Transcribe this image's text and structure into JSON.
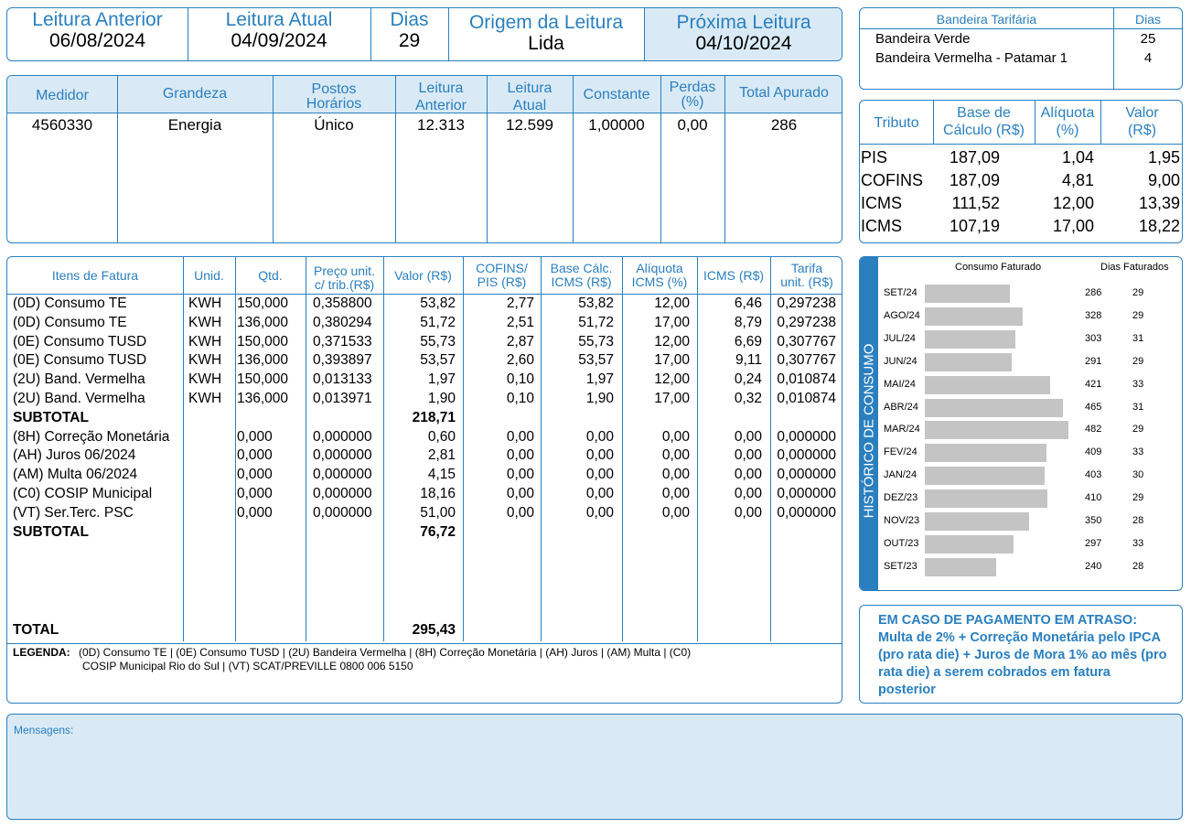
{
  "readings": {
    "anterior_label": "Leitura Anterior",
    "anterior_value": "06/08/2024",
    "atual_label": "Leitura Atual",
    "atual_value": "04/09/2024",
    "dias_label": "Dias",
    "dias_value": "29",
    "origem_label": "Origem da Leitura",
    "origem_value": "Lida",
    "proxima_label": "Próxima Leitura",
    "proxima_value": "04/10/2024"
  },
  "bandeira": {
    "header": "Bandeira Tarifária",
    "dias_header": "Dias",
    "rows": [
      {
        "name": "Bandeira Verde",
        "dias": "25"
      },
      {
        "name": "Bandeira Vermelha - Patamar 1",
        "dias": "4"
      }
    ]
  },
  "medidor": {
    "headers": {
      "medidor": "Medidor",
      "grandeza": "Grandeza",
      "postos_1": "Postos",
      "postos_2": "Horários",
      "anterior_1": "Leitura",
      "anterior_2": "Anterior",
      "atual_1": "Leitura",
      "atual_2": "Atual",
      "constante": "Constante",
      "perdas_1": "Perdas",
      "perdas_2": "(%)",
      "total": "Total Apurado"
    },
    "row": {
      "medidor": "4560330",
      "grandeza": "Energia",
      "postos": "Único",
      "anterior": "12.313",
      "atual": "12.599",
      "constante": "1,00000",
      "perdas": "0,00",
      "total": "286"
    }
  },
  "tributos": {
    "headers": {
      "tributo": "Tributo",
      "base_1": "Base de",
      "base_2": "Cálculo (R$)",
      "aliq_1": "Alíquota",
      "aliq_2": "(%)",
      "valor_1": "Valor",
      "valor_2": "(R$)"
    },
    "rows": [
      {
        "tributo": "PIS",
        "base": "187,09",
        "aliquota": "1,04",
        "valor": "1,95"
      },
      {
        "tributo": "COFINS",
        "base": "187,09",
        "aliquota": "4,81",
        "valor": "9,00"
      },
      {
        "tributo": "ICMS",
        "base": "111,52",
        "aliquota": "12,00",
        "valor": "13,39"
      },
      {
        "tributo": "ICMS",
        "base": "107,19",
        "aliquota": "17,00",
        "valor": "18,22"
      }
    ]
  },
  "itens": {
    "headers": {
      "itens": "Itens de Fatura",
      "unid": "Unid.",
      "qtd": "Qtd.",
      "preco_1": "Preço unit.",
      "preco_2": "c/ trib.(R$)",
      "valor": "Valor (R$)",
      "cofins_1": "COFINS/",
      "cofins_2": "PIS (R$)",
      "base_1": "Base Cálc.",
      "base_2": "ICMS (R$)",
      "aliq_1": "Alíquota",
      "aliq_2": "ICMS (%)",
      "icms": "ICMS (R$)",
      "tarifa_1": "Tarifa",
      "tarifa_2": "unit. (R$)"
    },
    "rows": [
      {
        "item": "(0D) Consumo TE",
        "unid": "KWH",
        "qtd": "150,000",
        "preco": "0,358800",
        "valor": "53,82",
        "cofins": "2,77",
        "base": "53,82",
        "aliq": "12,00",
        "icms": "6,46",
        "tarifa": "0,297238"
      },
      {
        "item": "(0D) Consumo TE",
        "unid": "KWH",
        "qtd": "136,000",
        "preco": "0,380294",
        "valor": "51,72",
        "cofins": "2,51",
        "base": "51,72",
        "aliq": "17,00",
        "icms": "8,79",
        "tarifa": "0,297238"
      },
      {
        "item": "(0E) Consumo TUSD",
        "unid": "KWH",
        "qtd": "150,000",
        "preco": "0,371533",
        "valor": "55,73",
        "cofins": "2,87",
        "base": "55,73",
        "aliq": "12,00",
        "icms": "6,69",
        "tarifa": "0,307767"
      },
      {
        "item": "(0E) Consumo TUSD",
        "unid": "KWH",
        "qtd": "136,000",
        "preco": "0,393897",
        "valor": "53,57",
        "cofins": "2,60",
        "base": "53,57",
        "aliq": "17,00",
        "icms": "9,11",
        "tarifa": "0,307767"
      },
      {
        "item": "(2U) Band. Vermelha",
        "unid": "KWH",
        "qtd": "150,000",
        "preco": "0,013133",
        "valor": "1,97",
        "cofins": "0,10",
        "base": "1,97",
        "aliq": "12,00",
        "icms": "0,24",
        "tarifa": "0,010874"
      },
      {
        "item": "(2U) Band. Vermelha",
        "unid": "KWH",
        "qtd": "136,000",
        "preco": "0,013971",
        "valor": "1,90",
        "cofins": "0,10",
        "base": "1,90",
        "aliq": "17,00",
        "icms": "0,32",
        "tarifa": "0,010874"
      },
      {
        "item": "SUBTOTAL",
        "bold": true,
        "valor": "218,71"
      },
      {
        "item": "(8H) Correção Monetária",
        "qtd": "0,000",
        "preco": "0,000000",
        "valor": "0,60",
        "cofins": "0,00",
        "base": "0,00",
        "aliq": "0,00",
        "icms": "0,00",
        "tarifa": "0,000000"
      },
      {
        "item": "(AH) Juros  06/2024",
        "qtd": "0,000",
        "preco": "0,000000",
        "valor": "2,81",
        "cofins": "0,00",
        "base": "0,00",
        "aliq": "0,00",
        "icms": "0,00",
        "tarifa": "0,000000"
      },
      {
        "item": "(AM) Multa  06/2024",
        "qtd": "0,000",
        "preco": "0,000000",
        "valor": "4,15",
        "cofins": "0,00",
        "base": "0,00",
        "aliq": "0,00",
        "icms": "0,00",
        "tarifa": "0,000000"
      },
      {
        "item": "(C0) COSIP Municipal",
        "qtd": "0,000",
        "preco": "0,000000",
        "valor": "18,16",
        "cofins": "0,00",
        "base": "0,00",
        "aliq": "0,00",
        "icms": "0,00",
        "tarifa": "0,000000"
      },
      {
        "item": "(VT) Ser.Terc. PSC",
        "qtd": "0,000",
        "preco": "0,000000",
        "valor": "51,00",
        "cofins": "0,00",
        "base": "0,00",
        "aliq": "0,00",
        "icms": "0,00",
        "tarifa": "0,000000"
      },
      {
        "item": "SUBTOTAL",
        "bold": true,
        "valor": "76,72"
      }
    ],
    "total_label": "TOTAL",
    "total_value": "295,43",
    "legenda_label": "LEGENDA:",
    "legenda_line1": "(0D) Consumo TE | (0E) Consumo TUSD | (2U) Bandeira Vermelha | (8H) Correção Monetária | (AH) Juros | (AM) Multa | (C0)",
    "legenda_line2": "COSIP Municipal Rio do Sul | (VT) SCAT/PREVILLE 0800 006 5150"
  },
  "historico": {
    "side_title": "HISTÓRICO DE CONSUMO",
    "col_consumo": "Consumo Faturado",
    "col_dias": "Dias Faturados",
    "rows": [
      {
        "mes": "SET/24",
        "consumo": 286,
        "dias": "29"
      },
      {
        "mes": "AGO/24",
        "consumo": 328,
        "dias": "29"
      },
      {
        "mes": "JUL/24",
        "consumo": 303,
        "dias": "31"
      },
      {
        "mes": "JUN/24",
        "consumo": 291,
        "dias": "29"
      },
      {
        "mes": "MAI/24",
        "consumo": 421,
        "dias": "33"
      },
      {
        "mes": "ABR/24",
        "consumo": 465,
        "dias": "31"
      },
      {
        "mes": "MAR/24",
        "consumo": 482,
        "dias": "29"
      },
      {
        "mes": "FEV/24",
        "consumo": 409,
        "dias": "33"
      },
      {
        "mes": "JAN/24",
        "consumo": 403,
        "dias": "30"
      },
      {
        "mes": "DEZ/23",
        "consumo": 410,
        "dias": "29"
      },
      {
        "mes": "NOV/23",
        "consumo": 350,
        "dias": "28"
      },
      {
        "mes": "OUT/23",
        "consumo": 297,
        "dias": "33"
      },
      {
        "mes": "SET/23",
        "consumo": 240,
        "dias": "28"
      }
    ]
  },
  "atraso": {
    "text": "EM CASO DE PAGAMENTO EM ATRASO: Multa de 2% + Correção Monetária pelo IPCA (pro rata die) + Juros de Mora 1% ao mês (pro rata die) a serem cobrados em fatura posterior"
  },
  "mensagens": {
    "label": "Mensagens:"
  },
  "colors": {
    "accent": "#2a7fbf",
    "panel": "#d9eaf6",
    "sidebar": "#2a7fbf",
    "bar": "#c4c4c4"
  }
}
